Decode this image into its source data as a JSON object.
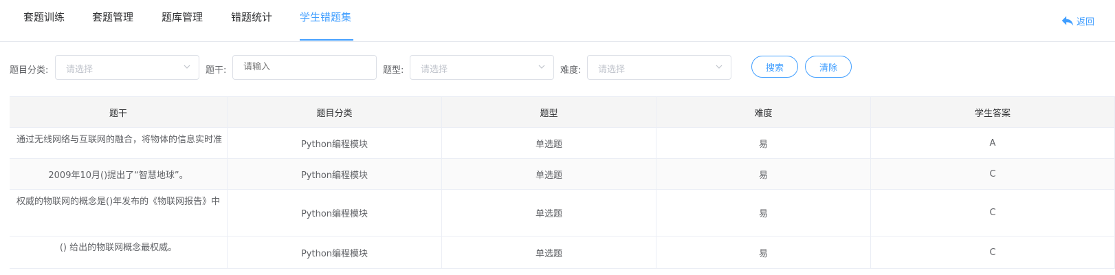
{
  "tabs": [
    {
      "label": "套题训练"
    },
    {
      "label": "套题管理"
    },
    {
      "label": "题库管理"
    },
    {
      "label": "错题统计"
    },
    {
      "label": "学生错题集"
    }
  ],
  "active_tab": "学生错题集",
  "back_label": "返回",
  "filters": {
    "category_label": "题目分类:",
    "category_placeholder": "请选择",
    "stem_label": "题干:",
    "stem_placeholder": "请输入",
    "type_label": "题型:",
    "type_placeholder": "请选择",
    "difficulty_label": "难度:",
    "difficulty_placeholder": "请选择"
  },
  "buttons": {
    "search": "搜索",
    "clear": "清除"
  },
  "table": {
    "headers": [
      "题干",
      "题目分类",
      "题型",
      "难度",
      "学生答案"
    ],
    "rows": [
      [
        "通过无线网络与互联网的融合，将物体的信息实时准",
        "Python编程模块",
        "单选题",
        "易",
        "A"
      ],
      [
        "2009年10月()提出了“智慧地球”。",
        "Python编程模块",
        "单选题",
        "易",
        "C"
      ],
      [
        "权威的物联网的概念是()年发布的《物联网报告》中",
        "Python编程模块",
        "单选题",
        "易",
        "C"
      ],
      [
        "()  给出的物联网概念最权威。",
        "Python编程模块",
        "单选题",
        "易",
        "C"
      ]
    ]
  }
}
